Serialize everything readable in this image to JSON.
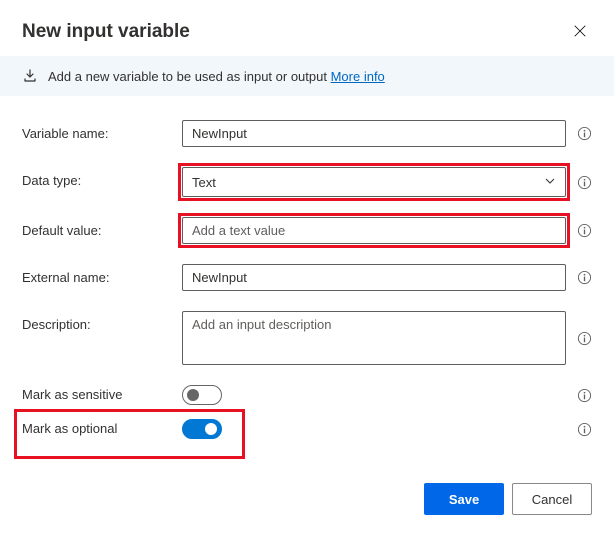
{
  "dialog": {
    "title": "New input variable",
    "info_text": "Add a new variable to be used as input or output",
    "more_info_label": "More info"
  },
  "fields": {
    "variable_name": {
      "label": "Variable name:",
      "value": "NewInput"
    },
    "data_type": {
      "label": "Data type:",
      "value": "Text"
    },
    "default_value": {
      "label": "Default value:",
      "placeholder": "Add a text value"
    },
    "external_name": {
      "label": "External name:",
      "value": "NewInput"
    },
    "description": {
      "label": "Description:",
      "placeholder": "Add an input description"
    },
    "sensitive": {
      "label": "Mark as sensitive",
      "on": false
    },
    "optional": {
      "label": "Mark as optional",
      "on": true
    }
  },
  "buttons": {
    "save": "Save",
    "cancel": "Cancel"
  }
}
